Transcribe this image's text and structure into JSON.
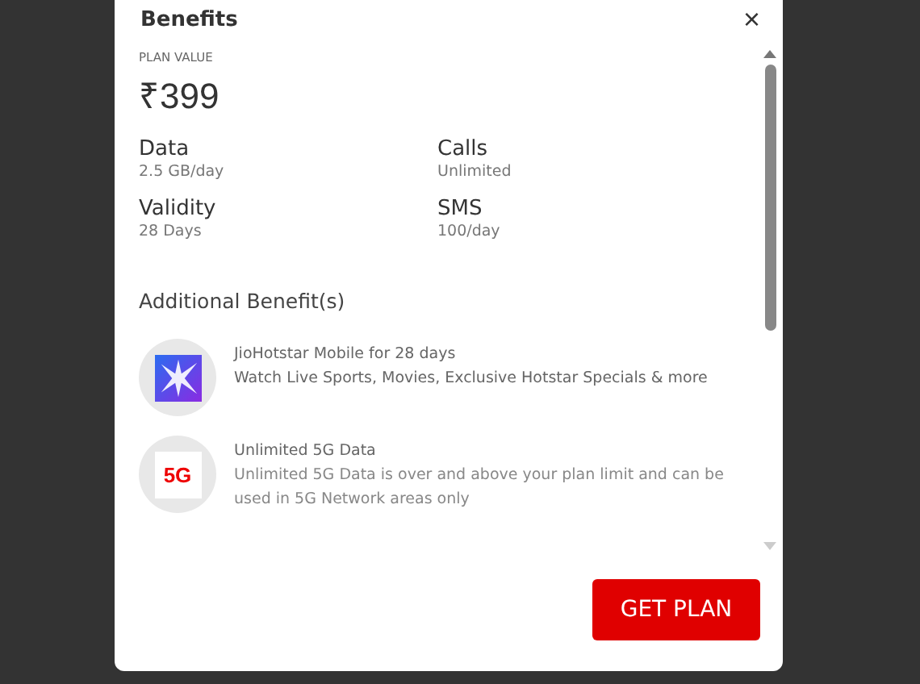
{
  "dialog": {
    "title": "Benefits",
    "close": "×"
  },
  "plan_value": {
    "label": "PLAN VALUE",
    "price": "₹399"
  },
  "features": [
    {
      "name": "Data",
      "value": "2.5 GB/day"
    },
    {
      "name": "Calls",
      "value": "Unlimited"
    },
    {
      "name": "Validity",
      "value": "28 Days"
    },
    {
      "name": "SMS",
      "value": "100/day"
    }
  ],
  "additional": {
    "heading": "Additional Benefit(s)",
    "items": [
      {
        "kind": "star",
        "title": "JioHotstar Mobile for 28 days",
        "description": "Watch Live Sports, Movies, Exclusive Hotstar Specials & more"
      },
      {
        "kind": "badge",
        "icon_text": "5G",
        "title": "Unlimited 5G Data",
        "description": "Unlimited 5G Data is over and above your plan limit and can be used in 5G Network areas only"
      }
    ]
  },
  "button": "GET PLAN"
}
